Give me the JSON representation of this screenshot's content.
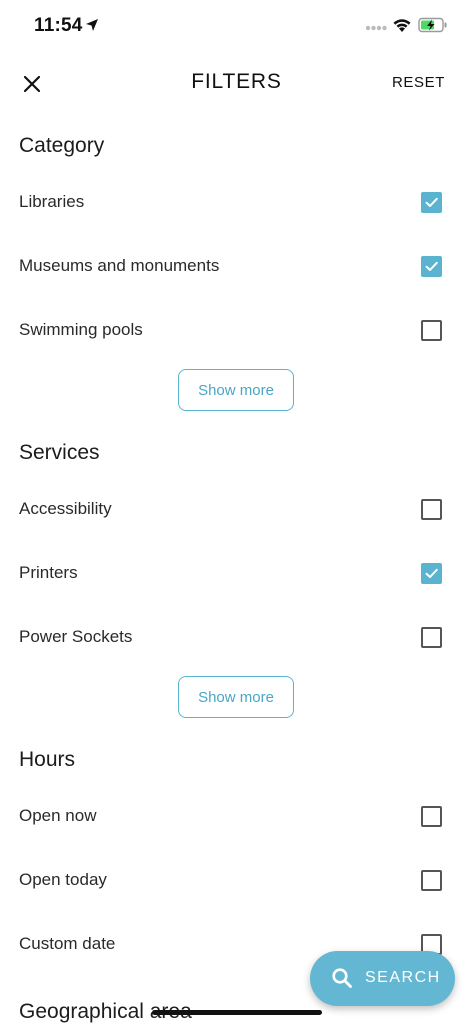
{
  "status_bar": {
    "time": "11:54"
  },
  "header": {
    "title": "FILTERS",
    "reset_label": "RESET"
  },
  "sections": {
    "category": {
      "title": "Category",
      "options": [
        {
          "label": "Libraries",
          "checked": true
        },
        {
          "label": "Museums and monuments",
          "checked": true
        },
        {
          "label": "Swimming pools",
          "checked": false
        }
      ],
      "show_more_label": "Show more"
    },
    "services": {
      "title": "Services",
      "options": [
        {
          "label": "Accessibility",
          "checked": false
        },
        {
          "label": "Printers",
          "checked": true
        },
        {
          "label": "Power Sockets",
          "checked": false
        }
      ],
      "show_more_label": "Show more"
    },
    "hours": {
      "title": "Hours",
      "options": [
        {
          "label": "Open now",
          "checked": false
        },
        {
          "label": "Open today",
          "checked": false
        },
        {
          "label": "Custom date",
          "checked": false
        }
      ]
    },
    "geo": {
      "title": "Geographical area"
    }
  },
  "search_button": {
    "label": "SEARCH"
  },
  "colors": {
    "accent": "#5ab3cf",
    "fab": "#63b7d3",
    "text": "#222222"
  }
}
